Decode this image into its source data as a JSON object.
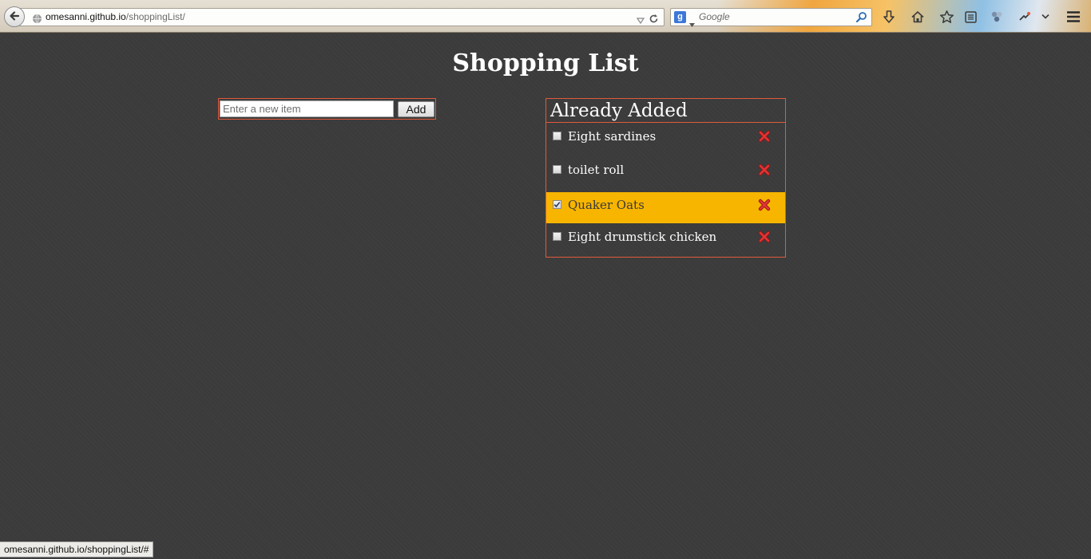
{
  "browser": {
    "url_host": "omesanni.github.io",
    "url_path": "/shoppingList/",
    "search_engine_logo": "g",
    "search_placeholder": "Google",
    "toolbar_icons": [
      "download-icon",
      "home-icon",
      "bookmark-star-icon",
      "reading-list-icon",
      "addon-icon",
      "extension-icon",
      "menu-dropdown-icon",
      "hamburger-menu-icon"
    ]
  },
  "page": {
    "title": "Shopping List"
  },
  "form": {
    "input_value": "",
    "input_placeholder": "Enter a new item",
    "add_label": "Add"
  },
  "panel": {
    "title": "Already Added",
    "items": [
      {
        "label": "Eight sardines",
        "checked": false
      },
      {
        "label": "toilet roll",
        "checked": false
      },
      {
        "label": "Quaker Oats",
        "checked": true
      },
      {
        "label": "Eight drumstick chicken",
        "checked": false
      }
    ]
  },
  "status": {
    "text": "omesanni.github.io/shoppingList/#"
  },
  "colors": {
    "background": "#3b3b3b",
    "accent_border": "#e05a3c",
    "highlight": "#f7b500",
    "delete": "#d42a2a"
  }
}
